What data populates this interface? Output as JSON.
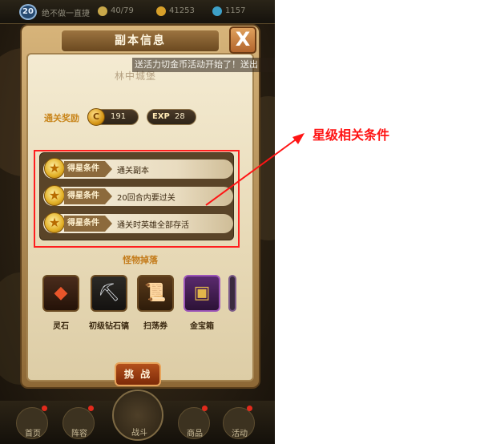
{
  "top_bar": {
    "level": "20",
    "player_name": "绝不做一直捷",
    "energy": "40/79",
    "gold": "41253",
    "gems": "1157"
  },
  "dialog": {
    "title": "副本信息",
    "close": "X",
    "marquee": "送活力切金币活动开始了！送出",
    "dungeon_name": "林中城堡"
  },
  "rewards": {
    "label": "通关奖励",
    "coin_glyph": "C",
    "gold": "191",
    "exp_label": "EXP",
    "exp": "28"
  },
  "conditions": [
    {
      "tag": "得星条件",
      "text": "通关副本"
    },
    {
      "tag": "得星条件",
      "text": "20回合内要过关"
    },
    {
      "tag": "得星条件",
      "text": "通关时英雄全部存活"
    }
  ],
  "drops": {
    "title": "怪物掉落",
    "items": [
      {
        "label": "灵石"
      },
      {
        "label": "初级钻石镐"
      },
      {
        "label": "扫荡券"
      },
      {
        "label": "金宝箱"
      }
    ]
  },
  "challenge_button": "挑 战",
  "bottom_nav": [
    "首页",
    "阵容",
    "战斗",
    "商品",
    "活动"
  ],
  "annotation": {
    "label": "星级相关条件",
    "color": "#ff1414"
  }
}
